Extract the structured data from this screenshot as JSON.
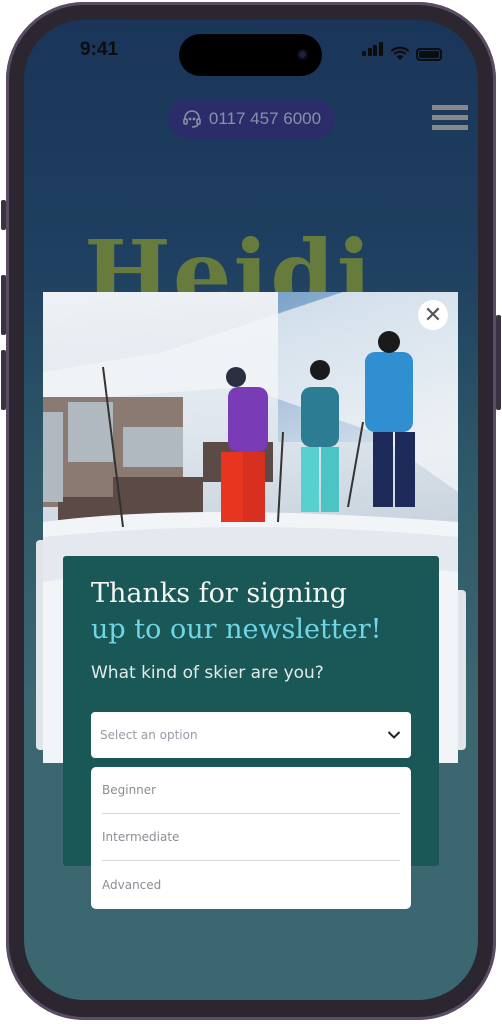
{
  "status_bar": {
    "time": "9:41"
  },
  "header": {
    "phone": "0117 457 6000",
    "logo": "Heidi"
  },
  "modal": {
    "title_line1": "Thanks for signing",
    "title_line2": "up to our newsletter!",
    "question": "What kind of skier are you?",
    "select_placeholder": "Select an option",
    "options": [
      "Beginner",
      "Intermediate",
      "Advanced"
    ]
  },
  "colors": {
    "card": "#1a5757",
    "accent": "#6fd6e6",
    "logo": "#677b3d",
    "phone_pill": "#2b2d6a"
  }
}
